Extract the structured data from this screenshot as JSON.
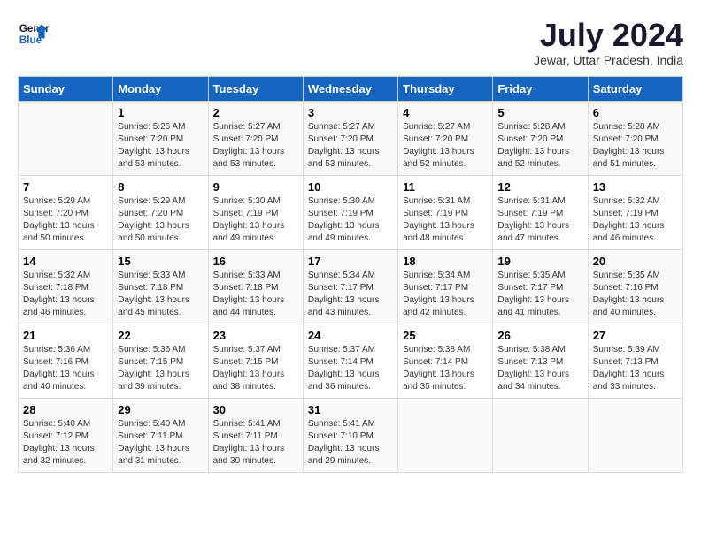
{
  "logo": {
    "line1": "General",
    "line2": "Blue"
  },
  "title": "July 2024",
  "location": "Jewar, Uttar Pradesh, India",
  "days_header": [
    "Sunday",
    "Monday",
    "Tuesday",
    "Wednesday",
    "Thursday",
    "Friday",
    "Saturday"
  ],
  "weeks": [
    [
      {
        "day": "",
        "info": ""
      },
      {
        "day": "1",
        "info": "Sunrise: 5:26 AM\nSunset: 7:20 PM\nDaylight: 13 hours\nand 53 minutes."
      },
      {
        "day": "2",
        "info": "Sunrise: 5:27 AM\nSunset: 7:20 PM\nDaylight: 13 hours\nand 53 minutes."
      },
      {
        "day": "3",
        "info": "Sunrise: 5:27 AM\nSunset: 7:20 PM\nDaylight: 13 hours\nand 53 minutes."
      },
      {
        "day": "4",
        "info": "Sunrise: 5:27 AM\nSunset: 7:20 PM\nDaylight: 13 hours\nand 52 minutes."
      },
      {
        "day": "5",
        "info": "Sunrise: 5:28 AM\nSunset: 7:20 PM\nDaylight: 13 hours\nand 52 minutes."
      },
      {
        "day": "6",
        "info": "Sunrise: 5:28 AM\nSunset: 7:20 PM\nDaylight: 13 hours\nand 51 minutes."
      }
    ],
    [
      {
        "day": "7",
        "info": "Sunrise: 5:29 AM\nSunset: 7:20 PM\nDaylight: 13 hours\nand 50 minutes."
      },
      {
        "day": "8",
        "info": "Sunrise: 5:29 AM\nSunset: 7:20 PM\nDaylight: 13 hours\nand 50 minutes."
      },
      {
        "day": "9",
        "info": "Sunrise: 5:30 AM\nSunset: 7:19 PM\nDaylight: 13 hours\nand 49 minutes."
      },
      {
        "day": "10",
        "info": "Sunrise: 5:30 AM\nSunset: 7:19 PM\nDaylight: 13 hours\nand 49 minutes."
      },
      {
        "day": "11",
        "info": "Sunrise: 5:31 AM\nSunset: 7:19 PM\nDaylight: 13 hours\nand 48 minutes."
      },
      {
        "day": "12",
        "info": "Sunrise: 5:31 AM\nSunset: 7:19 PM\nDaylight: 13 hours\nand 47 minutes."
      },
      {
        "day": "13",
        "info": "Sunrise: 5:32 AM\nSunset: 7:19 PM\nDaylight: 13 hours\nand 46 minutes."
      }
    ],
    [
      {
        "day": "14",
        "info": "Sunrise: 5:32 AM\nSunset: 7:18 PM\nDaylight: 13 hours\nand 46 minutes."
      },
      {
        "day": "15",
        "info": "Sunrise: 5:33 AM\nSunset: 7:18 PM\nDaylight: 13 hours\nand 45 minutes."
      },
      {
        "day": "16",
        "info": "Sunrise: 5:33 AM\nSunset: 7:18 PM\nDaylight: 13 hours\nand 44 minutes."
      },
      {
        "day": "17",
        "info": "Sunrise: 5:34 AM\nSunset: 7:17 PM\nDaylight: 13 hours\nand 43 minutes."
      },
      {
        "day": "18",
        "info": "Sunrise: 5:34 AM\nSunset: 7:17 PM\nDaylight: 13 hours\nand 42 minutes."
      },
      {
        "day": "19",
        "info": "Sunrise: 5:35 AM\nSunset: 7:17 PM\nDaylight: 13 hours\nand 41 minutes."
      },
      {
        "day": "20",
        "info": "Sunrise: 5:35 AM\nSunset: 7:16 PM\nDaylight: 13 hours\nand 40 minutes."
      }
    ],
    [
      {
        "day": "21",
        "info": "Sunrise: 5:36 AM\nSunset: 7:16 PM\nDaylight: 13 hours\nand 40 minutes."
      },
      {
        "day": "22",
        "info": "Sunrise: 5:36 AM\nSunset: 7:15 PM\nDaylight: 13 hours\nand 39 minutes."
      },
      {
        "day": "23",
        "info": "Sunrise: 5:37 AM\nSunset: 7:15 PM\nDaylight: 13 hours\nand 38 minutes."
      },
      {
        "day": "24",
        "info": "Sunrise: 5:37 AM\nSunset: 7:14 PM\nDaylight: 13 hours\nand 36 minutes."
      },
      {
        "day": "25",
        "info": "Sunrise: 5:38 AM\nSunset: 7:14 PM\nDaylight: 13 hours\nand 35 minutes."
      },
      {
        "day": "26",
        "info": "Sunrise: 5:38 AM\nSunset: 7:13 PM\nDaylight: 13 hours\nand 34 minutes."
      },
      {
        "day": "27",
        "info": "Sunrise: 5:39 AM\nSunset: 7:13 PM\nDaylight: 13 hours\nand 33 minutes."
      }
    ],
    [
      {
        "day": "28",
        "info": "Sunrise: 5:40 AM\nSunset: 7:12 PM\nDaylight: 13 hours\nand 32 minutes."
      },
      {
        "day": "29",
        "info": "Sunrise: 5:40 AM\nSunset: 7:11 PM\nDaylight: 13 hours\nand 31 minutes."
      },
      {
        "day": "30",
        "info": "Sunrise: 5:41 AM\nSunset: 7:11 PM\nDaylight: 13 hours\nand 30 minutes."
      },
      {
        "day": "31",
        "info": "Sunrise: 5:41 AM\nSunset: 7:10 PM\nDaylight: 13 hours\nand 29 minutes."
      },
      {
        "day": "",
        "info": ""
      },
      {
        "day": "",
        "info": ""
      },
      {
        "day": "",
        "info": ""
      }
    ]
  ]
}
